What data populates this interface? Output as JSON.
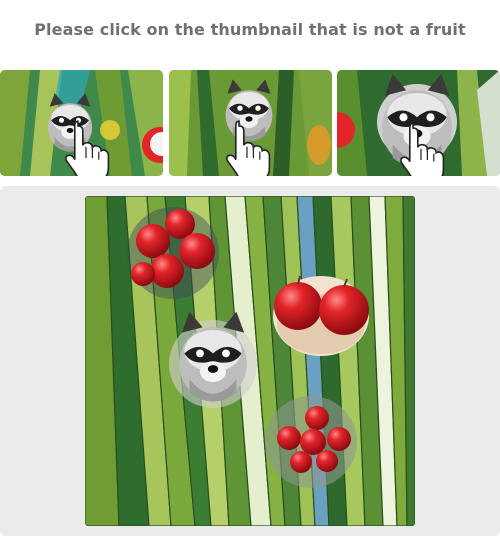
{
  "prompt": {
    "text": "Please click on the thumbnail that is not a fruit"
  },
  "thumbnails": [
    {
      "subject": "raccoon",
      "cursor_icon": "hand-pointer-icon"
    },
    {
      "subject": "raccoon",
      "cursor_icon": "hand-pointer-icon"
    },
    {
      "subject": "raccoon",
      "cursor_icon": "hand-pointer-icon"
    }
  ],
  "main_image": {
    "background": "leaf-stripes",
    "items": [
      "apples-cluster",
      "apples-plate",
      "raccoon",
      "apples-bowl"
    ]
  },
  "colors": {
    "prompt_text": "#707070",
    "panel_bg": "#ebebeb",
    "leaf_green": "#7fa53a",
    "apple_red": "#c8171c"
  }
}
